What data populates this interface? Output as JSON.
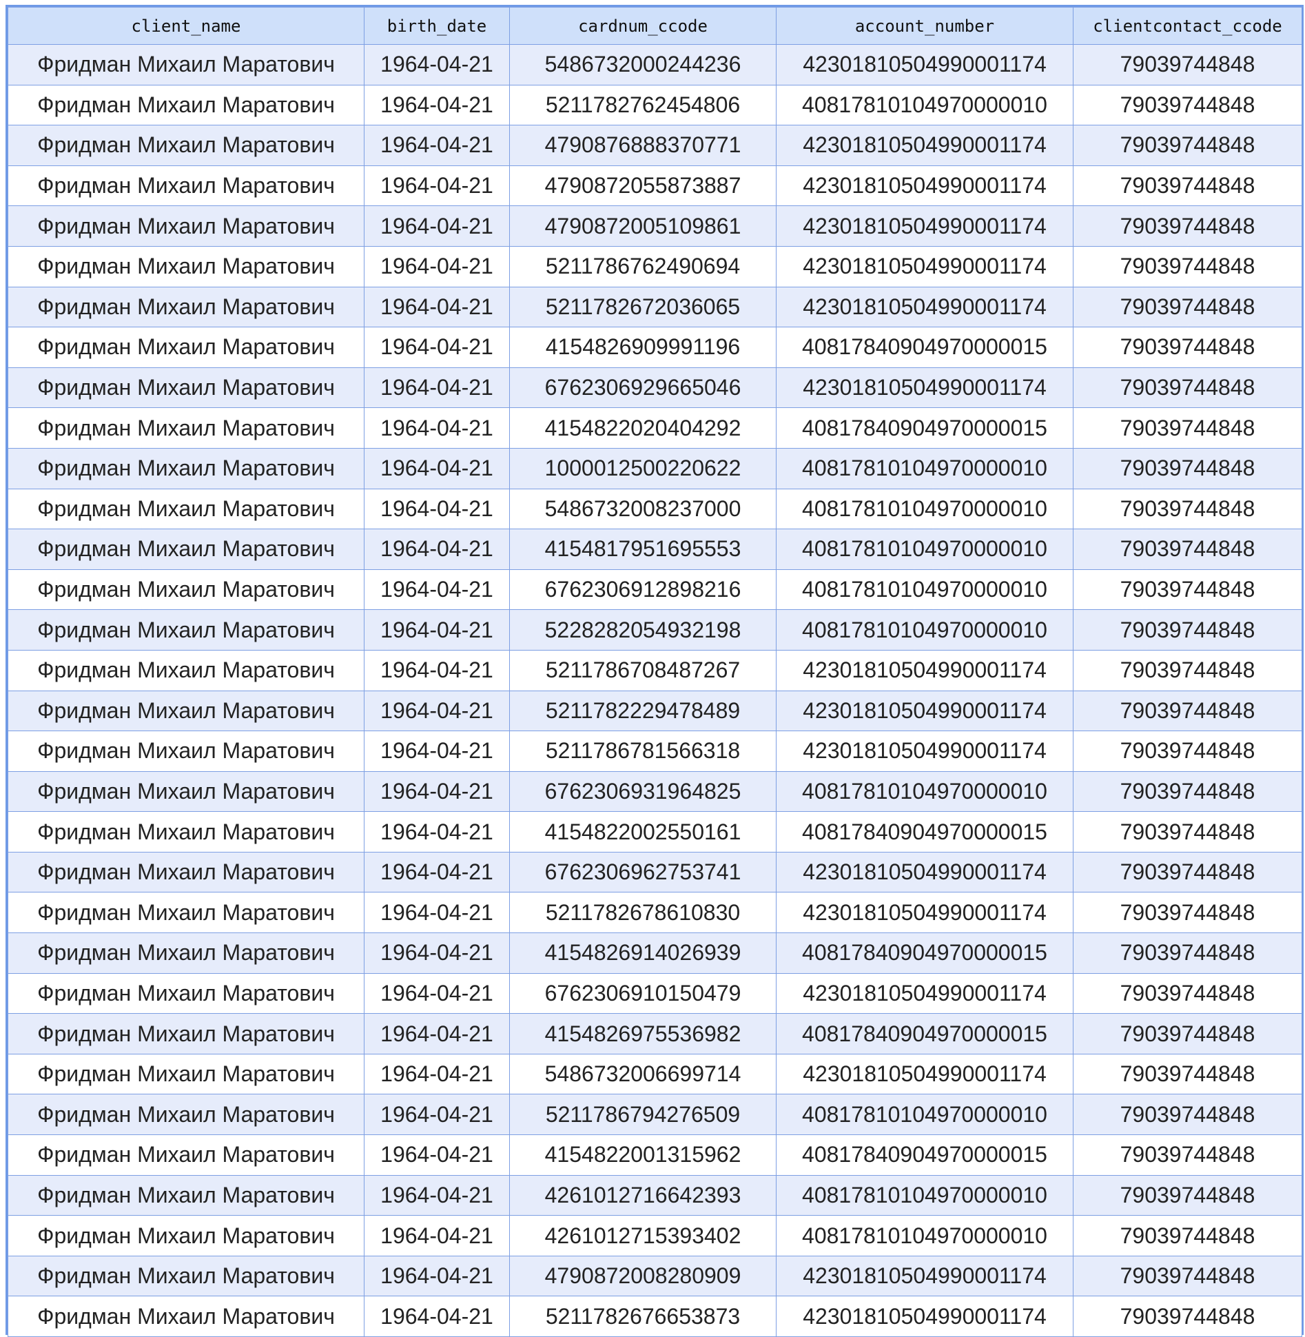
{
  "table": {
    "columns": [
      "client_name",
      "birth_date",
      "cardnum_ccode",
      "account_number",
      "clientcontact_ccode"
    ],
    "rows": [
      [
        "Фридман Михаил Маратович",
        "1964-04-21",
        "5486732000244236",
        "42301810504990001174",
        "79039744848"
      ],
      [
        "Фридман Михаил Маратович",
        "1964-04-21",
        "5211782762454806",
        "40817810104970000010",
        "79039744848"
      ],
      [
        "Фридман Михаил Маратович",
        "1964-04-21",
        "4790876888370771",
        "42301810504990001174",
        "79039744848"
      ],
      [
        "Фридман Михаил Маратович",
        "1964-04-21",
        "4790872055873887",
        "42301810504990001174",
        "79039744848"
      ],
      [
        "Фридман Михаил Маратович",
        "1964-04-21",
        "4790872005109861",
        "42301810504990001174",
        "79039744848"
      ],
      [
        "Фридман Михаил Маратович",
        "1964-04-21",
        "5211786762490694",
        "42301810504990001174",
        "79039744848"
      ],
      [
        "Фридман Михаил Маратович",
        "1964-04-21",
        "5211782672036065",
        "42301810504990001174",
        "79039744848"
      ],
      [
        "Фридман Михаил Маратович",
        "1964-04-21",
        "4154826909991196",
        "40817840904970000015",
        "79039744848"
      ],
      [
        "Фридман Михаил Маратович",
        "1964-04-21",
        "6762306929665046",
        "42301810504990001174",
        "79039744848"
      ],
      [
        "Фридман Михаил Маратович",
        "1964-04-21",
        "4154822020404292",
        "40817840904970000015",
        "79039744848"
      ],
      [
        "Фридман Михаил Маратович",
        "1964-04-21",
        "1000012500220622",
        "40817810104970000010",
        "79039744848"
      ],
      [
        "Фридман Михаил Маратович",
        "1964-04-21",
        "5486732008237000",
        "40817810104970000010",
        "79039744848"
      ],
      [
        "Фридман Михаил Маратович",
        "1964-04-21",
        "4154817951695553",
        "40817810104970000010",
        "79039744848"
      ],
      [
        "Фридман Михаил Маратович",
        "1964-04-21",
        "6762306912898216",
        "40817810104970000010",
        "79039744848"
      ],
      [
        "Фридман Михаил Маратович",
        "1964-04-21",
        "5228282054932198",
        "40817810104970000010",
        "79039744848"
      ],
      [
        "Фридман Михаил Маратович",
        "1964-04-21",
        "5211786708487267",
        "42301810504990001174",
        "79039744848"
      ],
      [
        "Фридман Михаил Маратович",
        "1964-04-21",
        "5211782229478489",
        "42301810504990001174",
        "79039744848"
      ],
      [
        "Фридман Михаил Маратович",
        "1964-04-21",
        "5211786781566318",
        "42301810504990001174",
        "79039744848"
      ],
      [
        "Фридман Михаил Маратович",
        "1964-04-21",
        "6762306931964825",
        "40817810104970000010",
        "79039744848"
      ],
      [
        "Фридман Михаил Маратович",
        "1964-04-21",
        "4154822002550161",
        "40817840904970000015",
        "79039744848"
      ],
      [
        "Фридман Михаил Маратович",
        "1964-04-21",
        "6762306962753741",
        "42301810504990001174",
        "79039744848"
      ],
      [
        "Фридман Михаил Маратович",
        "1964-04-21",
        "5211782678610830",
        "42301810504990001174",
        "79039744848"
      ],
      [
        "Фридман Михаил Маратович",
        "1964-04-21",
        "4154826914026939",
        "40817840904970000015",
        "79039744848"
      ],
      [
        "Фридман Михаил Маратович",
        "1964-04-21",
        "6762306910150479",
        "42301810504990001174",
        "79039744848"
      ],
      [
        "Фридман Михаил Маратович",
        "1964-04-21",
        "4154826975536982",
        "40817840904970000015",
        "79039744848"
      ],
      [
        "Фридман Михаил Маратович",
        "1964-04-21",
        "5486732006699714",
        "42301810504990001174",
        "79039744848"
      ],
      [
        "Фридман Михаил Маратович",
        "1964-04-21",
        "5211786794276509",
        "40817810104970000010",
        "79039744848"
      ],
      [
        "Фридман Михаил Маратович",
        "1964-04-21",
        "4154822001315962",
        "40817840904970000015",
        "79039744848"
      ],
      [
        "Фридман Михаил Маратович",
        "1964-04-21",
        "4261012716642393",
        "40817810104970000010",
        "79039744848"
      ],
      [
        "Фридман Михаил Маратович",
        "1964-04-21",
        "4261012715393402",
        "40817810104970000010",
        "79039744848"
      ],
      [
        "Фридман Михаил Маратович",
        "1964-04-21",
        "4790872008280909",
        "42301810504990001174",
        "79039744848"
      ],
      [
        "Фридман Михаил Маратович",
        "1964-04-21",
        "5211782676653873",
        "42301810504990001174",
        "79039744848"
      ]
    ]
  },
  "colors": {
    "header_bg": "#cfe0fa",
    "odd_row_bg": "#e6ecfb",
    "even_row_bg": "#ffffff",
    "grid_line": "#7d9fe3",
    "frame_border": "#6f9ae6"
  }
}
